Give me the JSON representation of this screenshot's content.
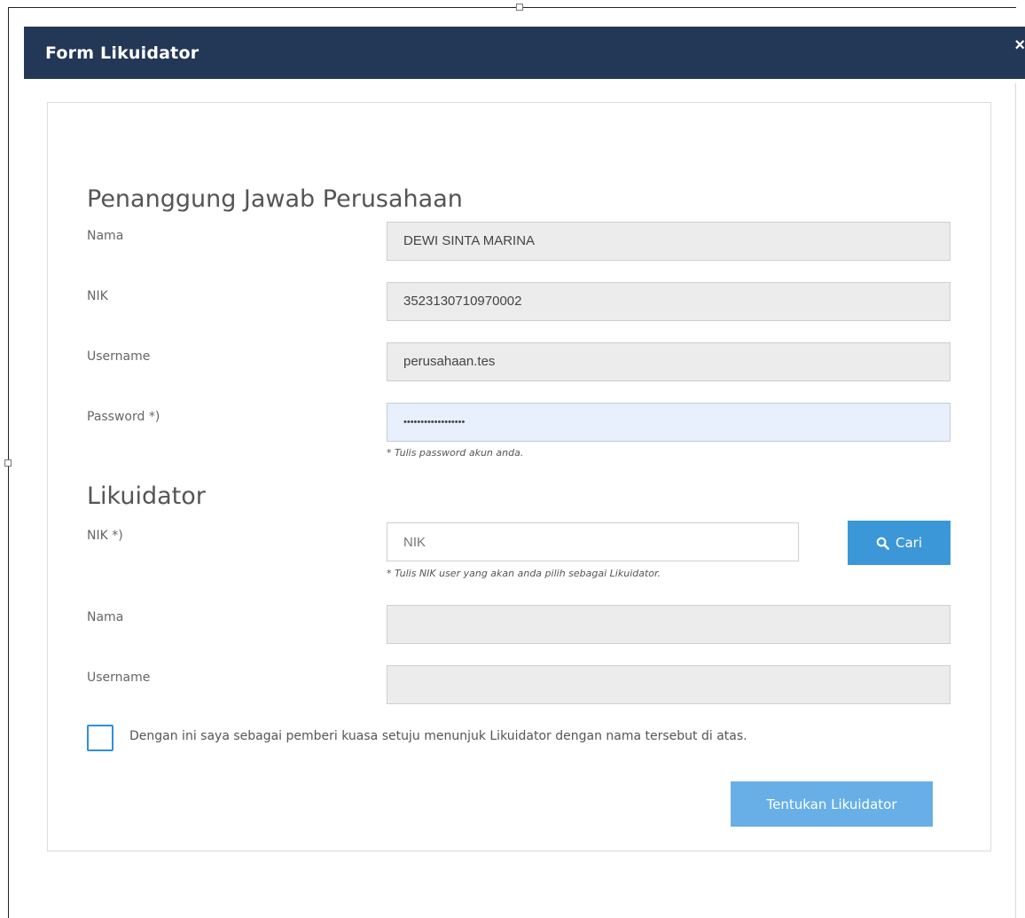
{
  "modal": {
    "title": "Form Likuidator",
    "close_icon": "close-icon"
  },
  "section_company": {
    "title": "Penanggung Jawab Perusahaan",
    "name_label": "Nama",
    "name_value": "DEWI SINTA MARINA",
    "nik_label": "NIK",
    "nik_value": "3523130710970002",
    "username_label": "Username",
    "username_value": "perusahaan.tes",
    "password_label": "Password *)",
    "password_value": "••••••••••••••••••",
    "password_hint": "* Tulis password akun anda."
  },
  "section_liquidator": {
    "title": "Likuidator",
    "nik_label": "NIK *)",
    "nik_placeholder": "NIK",
    "nik_hint": "* Tulis NIK user yang akan anda pilih sebagai Likuidator.",
    "search_button_label": "Cari",
    "name_label": "Nama",
    "name_value": "",
    "username_label": "Username",
    "username_value": ""
  },
  "agreement": {
    "label": "Dengan ini saya sebagai pemberi kuasa setuju menunjuk Likuidator dengan nama tersebut di atas.",
    "checked": false
  },
  "submit_button_label": "Tentukan Likuidator",
  "colors": {
    "header": "#233757",
    "primary": "#3c97d8",
    "submit": "#67afe6",
    "field_disabled": "#ececec",
    "field_autofill": "#e8f0fe"
  }
}
